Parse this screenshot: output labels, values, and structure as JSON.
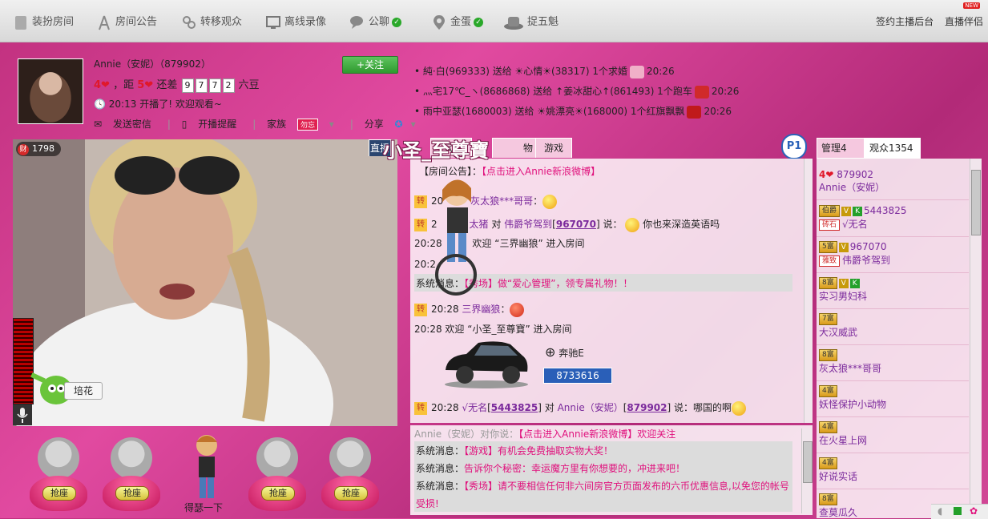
{
  "topnav": {
    "items": [
      {
        "label": "装扮房间",
        "icon": "book-icon"
      },
      {
        "label": "房间公告",
        "icon": "antenna-icon"
      },
      {
        "label": "转移观众",
        "icon": "link-icon"
      },
      {
        "label": "离线录像",
        "icon": "monitor-icon"
      },
      {
        "label": "公聊",
        "icon": "chat-bubble-icon",
        "checked": true
      },
      {
        "label": "金蛋",
        "icon": "location-pin-icon",
        "checked": true
      },
      {
        "label": "捉五魁",
        "icon": "hat-icon"
      }
    ],
    "right_links": [
      "签约主播后台",
      "直播伴侣"
    ],
    "new_badge": "NEW"
  },
  "anchor": {
    "name": "Annie（安妮）（879902）",
    "follow_label": "+关注",
    "level_current": "4",
    "level_text_mid": "，距",
    "level_next": "5",
    "level_text_need": "还差",
    "digits": [
      "9",
      "7",
      "7",
      "2"
    ],
    "level_unit": "六豆",
    "start_time": "20:13",
    "start_text": "开播了! 欢迎观看~",
    "actions": {
      "message": "发送密信",
      "remind": "开播提醒",
      "family": "家族",
      "family_badge": "勿忘",
      "share": "分享"
    }
  },
  "gifts": [
    {
      "text": "純·白(969333) 送给 ☀心情☀(38317) 1个求婚",
      "time": "20:26",
      "color": "#f0b0c8"
    },
    {
      "text": "灬宅17℃_ヽ(8686868) 送给 ↑姜冰甜心↑(861493) 1个跑车",
      "time": "20:26",
      "color": "#d02a2a"
    },
    {
      "text": "雨中亚瑟(1680003) 送给 ☀姚漂亮☀(168000) 1个红旗飘飘",
      "time": "20:26",
      "color": "#c01a1a"
    }
  ],
  "video": {
    "wealth_label": "财",
    "wealth_value": "1798",
    "flower_label": "培花"
  },
  "seats": {
    "button_label": "抢座",
    "occupant_name": "得瑟一下"
  },
  "tabs": [
    "直播",
    "动",
    "物",
    "游戏"
  ],
  "overlay_name": "小圣_至尊寶",
  "page_badge": "P1",
  "chat": {
    "announcement_label": "【房间公告】：",
    "announcement_link": "【点击进入Annie新浪微博】",
    "lines": [
      {
        "zhuan": "转",
        "time": "20",
        "name": "灰太狼***哥哥",
        "suffix": "："
      },
      {
        "zhuan": "转",
        "time": "2",
        "name": "太猪",
        "mid": "对",
        "target": "伟爵爷驾到",
        "target_id": "967070",
        "said": "说：",
        "msg": "你也来深造英语吗"
      },
      {
        "time": "20:28",
        "text": "欢迎 “三界幽狼” 进入房间"
      },
      {
        "time": "20:2"
      },
      {
        "sys_label": "系统消息：",
        "sys_text": "【秀场】做“爱心管理”，领专属礼物！！"
      },
      {
        "zhuan": "转",
        "time": "20:28",
        "name": "三界幽狼",
        "suffix": "："
      },
      {
        "time": "20:28",
        "text": "欢迎 “小圣_至尊寶” 进入房间"
      },
      {
        "zhuan": "转",
        "time": "20:28",
        "name": "√无名",
        "uid": "5443825",
        "mid": "对",
        "target": "Annie（安妮）",
        "target_id": "879902",
        "said": "说：哪国的啊"
      }
    ],
    "car_brand": "奔驰E",
    "car_number": "8733616"
  },
  "private_chat": [
    {
      "label": "Annie（安妮）对你说：",
      "text": "【点击进入Annie新浪微博】欢迎关注"
    },
    {
      "label": "系统消息：",
      "text": "【游戏】有机会免费抽取实物大奖！"
    },
    {
      "label": "系统消息：",
      "text": "告诉你个秘密：幸运魔方里有你想要的，冲进来吧！"
    },
    {
      "label": "系统消息：",
      "text": "【秀场】请不要相信任何非六间房官方页面发布的六币优惠信息,以免您的帐号"
    },
    {
      "label": "",
      "text": "受损!"
    }
  ],
  "userlist": {
    "tabs": [
      "管理4",
      "观众1354"
    ],
    "users": [
      {
        "level": "4",
        "id": "879902",
        "name": "Annie（安妮）",
        "badge": "heart"
      },
      {
        "level": "伯爵",
        "v": true,
        "k": true,
        "id": "5443825",
        "tag": "砖石",
        "name": "√无名"
      },
      {
        "level": "5富",
        "v": true,
        "id": "967070",
        "tag": "雅致",
        "name": "伟爵爷驾到"
      },
      {
        "level": "8富",
        "v": true,
        "k": true,
        "name": "实习男妇科"
      },
      {
        "level": "7富",
        "name": "大汉威武"
      },
      {
        "level": "8富",
        "name": "灰太狼***哥哥"
      },
      {
        "level": "4富",
        "name": "妖怪保护小动物"
      },
      {
        "level": "4富",
        "name": "在火星上网"
      },
      {
        "level": "4富",
        "name": "好说实话"
      },
      {
        "level": "8富",
        "name": "查莫瓜久"
      }
    ]
  },
  "colors": {
    "accent": "#e0107c",
    "nav_bg": "#e0e0e0",
    "panel_pink": "#f5c8df"
  }
}
